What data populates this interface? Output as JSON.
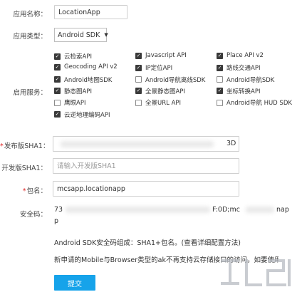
{
  "form": {
    "app_name": {
      "label": "应用名称：",
      "value": "LocationApp"
    },
    "app_type": {
      "label": "应用类型：",
      "value": "Android SDK"
    },
    "services": {
      "label": "启用服务：",
      "items": [
        {
          "label": "云检索API",
          "checked": true
        },
        {
          "label": "Javascript API",
          "checked": true
        },
        {
          "label": "Place API v2",
          "checked": true
        },
        {
          "label": "Geocoding API v2",
          "checked": true
        },
        {
          "label": "IP定位API",
          "checked": true
        },
        {
          "label": "路线交通API",
          "checked": true
        },
        {
          "label": "Android地图SDK",
          "checked": true
        },
        {
          "label": "Android导航离线SDK",
          "checked": false
        },
        {
          "label": "Android导航SDK",
          "checked": false
        },
        {
          "label": "静态图API",
          "checked": true
        },
        {
          "label": "全景静态图API",
          "checked": true
        },
        {
          "label": "坐标转换API",
          "checked": true
        },
        {
          "label": "鹰眼API",
          "checked": false
        },
        {
          "label": "全景URL API",
          "checked": false
        },
        {
          "label": "Android导航 HUD SDK",
          "checked": false
        },
        {
          "label": "云逆地理编码API",
          "checked": true
        }
      ]
    },
    "release_sha1": {
      "label": "发布版SHA1：",
      "required": "*",
      "value_suffix": "3D"
    },
    "dev_sha1": {
      "label": "开发版SHA1：",
      "placeholder": "请输入开发版SHA1"
    },
    "package": {
      "label": "包名：",
      "required": "*",
      "value": "mcsapp.locationapp"
    },
    "security_code": {
      "label": "安全码：",
      "line1_start": "73",
      "line1_mid": "F:0D;mc",
      "line1_end": "nap",
      "line2": "p"
    },
    "note1_prefix": "Android SDK安全码组成：SHA1+包名。",
    "note1_link": "(查看详细配置方法)",
    "note2": "新申请的Mobile与Browser类型的ak不再支持云存储接口的访问，如要使用云存储",
    "submit_label": "提交"
  },
  "colors": {
    "accent": "#16a3ea",
    "required": "#e02020"
  }
}
